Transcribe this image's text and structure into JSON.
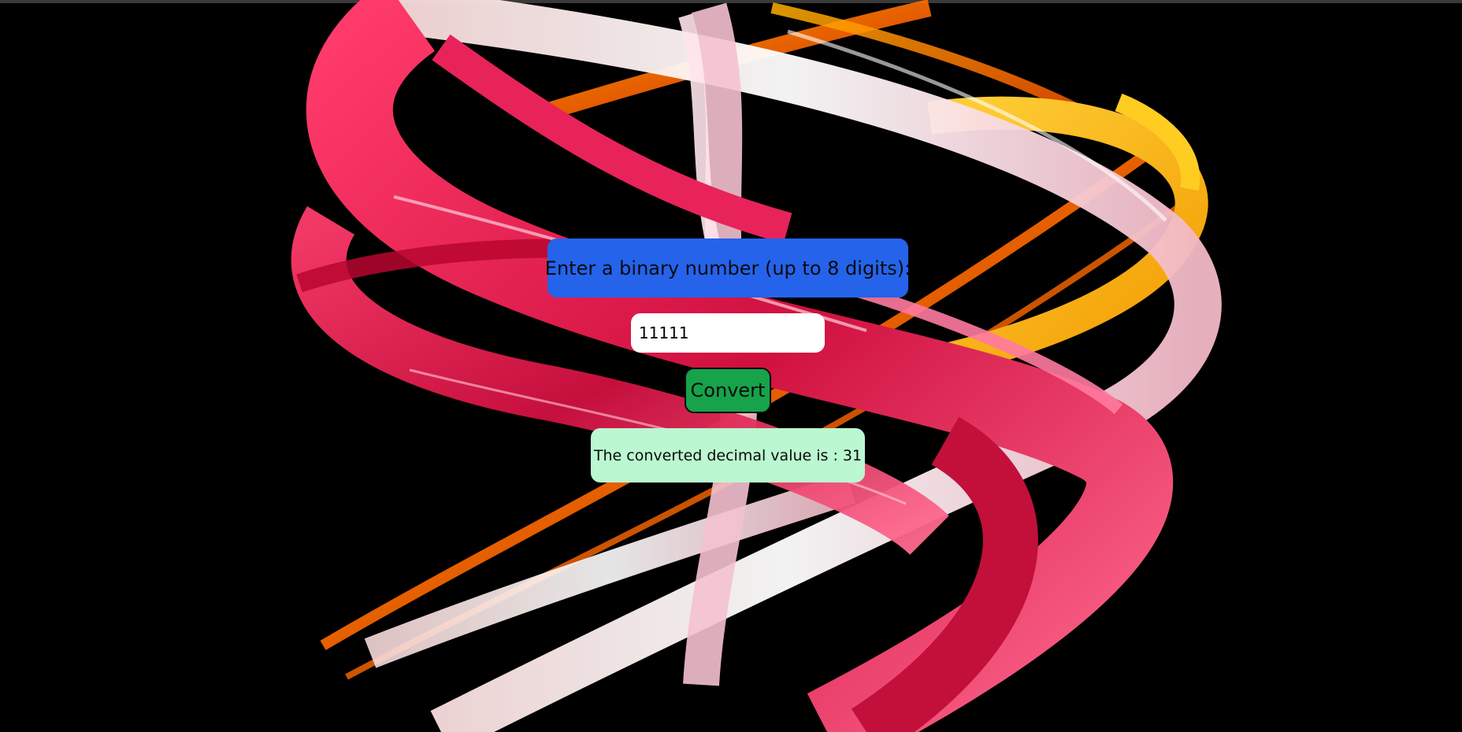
{
  "prompt": {
    "label": "Enter a binary number (up to 8 digits):"
  },
  "input": {
    "value": "11111"
  },
  "convert": {
    "label": "Convert"
  },
  "result": {
    "text": "The converted decimal value is : 31"
  },
  "colors": {
    "background": "#000000",
    "prompt_bg": "#2563eb",
    "button_bg": "#16a34a",
    "result_bg": "#bbf7d0",
    "input_bg": "#ffffff"
  }
}
